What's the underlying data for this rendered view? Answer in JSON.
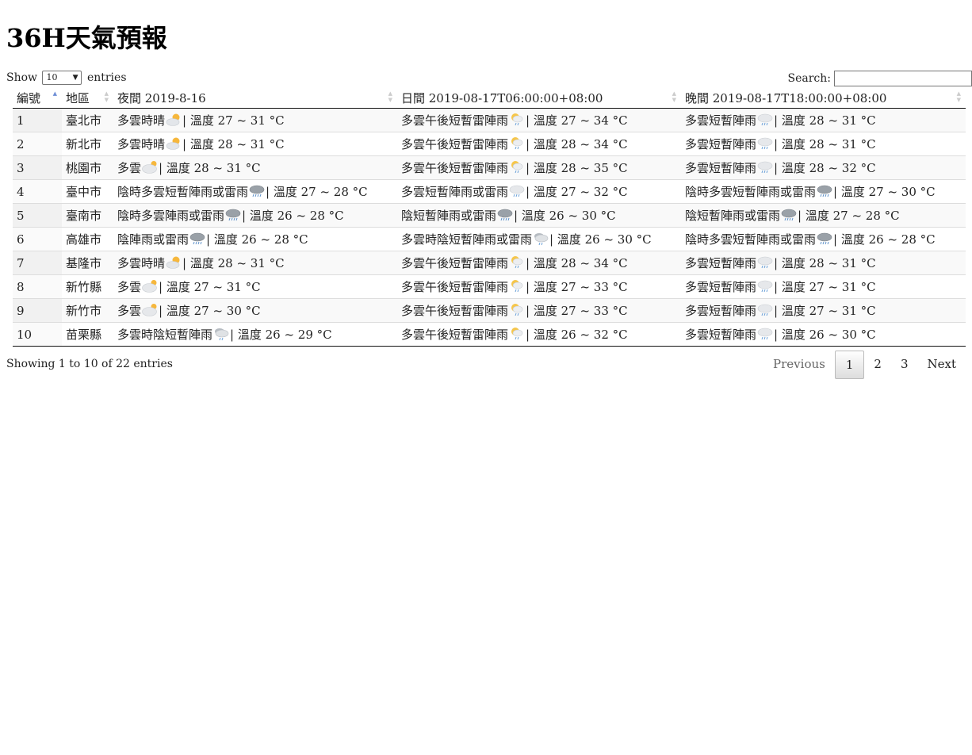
{
  "title": "36H天氣預報",
  "length": {
    "show_label": "Show",
    "value": "10",
    "entries_label": "entries"
  },
  "search": {
    "label": "Search:",
    "value": ""
  },
  "columns": [
    "編號",
    "地區",
    "夜間 2019-8-16",
    "日間 2019-08-17T06:00:00+08:00",
    "晚間 2019-08-17T18:00:00+08:00"
  ],
  "rows": [
    {
      "no": "1",
      "city": "臺北市",
      "p1": {
        "desc": "多雲時晴",
        "icon": "partly-sunny-icon",
        "temp": "| 溫度 27 ~ 31 °C"
      },
      "p2": {
        "desc": "多雲午後短暫雷陣雨",
        "icon": "sun-rain-icon",
        "temp": "| 溫度 27 ~ 34 °C"
      },
      "p3": {
        "desc": "多雲短暫陣雨",
        "icon": "cloud-rain-icon",
        "temp": "| 溫度 28 ~ 31 °C"
      }
    },
    {
      "no": "2",
      "city": "新北市",
      "p1": {
        "desc": "多雲時晴",
        "icon": "partly-sunny-icon",
        "temp": "| 溫度 28 ~ 31 °C"
      },
      "p2": {
        "desc": "多雲午後短暫雷陣雨",
        "icon": "sun-rain-icon",
        "temp": "| 溫度 28 ~ 34 °C"
      },
      "p3": {
        "desc": "多雲短暫陣雨",
        "icon": "cloud-rain-icon",
        "temp": "| 溫度 28 ~ 31 °C"
      }
    },
    {
      "no": "3",
      "city": "桃園市",
      "p1": {
        "desc": "多雲",
        "icon": "cloudy-icon",
        "temp": "| 溫度 28 ~ 31 °C"
      },
      "p2": {
        "desc": "多雲午後短暫雷陣雨",
        "icon": "sun-rain-icon",
        "temp": "| 溫度 28 ~ 35 °C"
      },
      "p3": {
        "desc": "多雲短暫陣雨",
        "icon": "cloud-rain-icon",
        "temp": "| 溫度 28 ~ 32 °C"
      }
    },
    {
      "no": "4",
      "city": "臺中市",
      "p1": {
        "desc": "陰時多雲短暫陣雨或雷雨",
        "icon": "thunder-rain-icon",
        "temp": "| 溫度 27 ~ 28 °C"
      },
      "p2": {
        "desc": "多雲短暫陣雨或雷雨",
        "icon": "cloud-rain-icon",
        "temp": "| 溫度 27 ~ 32 °C"
      },
      "p3": {
        "desc": "陰時多雲短暫陣雨或雷雨",
        "icon": "thunder-rain-icon",
        "temp": "| 溫度 27 ~ 30 °C"
      }
    },
    {
      "no": "5",
      "city": "臺南市",
      "p1": {
        "desc": "陰時多雲陣雨或雷雨",
        "icon": "thunder-rain-icon",
        "temp": "| 溫度 26 ~ 28 °C"
      },
      "p2": {
        "desc": "陰短暫陣雨或雷雨",
        "icon": "thunder-rain-icon",
        "temp": "| 溫度 26 ~ 30 °C"
      },
      "p3": {
        "desc": "陰短暫陣雨或雷雨",
        "icon": "thunder-rain-icon",
        "temp": "| 溫度 27 ~ 28 °C"
      }
    },
    {
      "no": "6",
      "city": "高雄市",
      "p1": {
        "desc": "陰陣雨或雷雨",
        "icon": "thunder-rain-icon",
        "temp": "| 溫度 26 ~ 28 °C"
      },
      "p2": {
        "desc": "多雲時陰短暫陣雨或雷雨",
        "icon": "overcast-rain-icon",
        "temp": "| 溫度 26 ~ 30 °C"
      },
      "p3": {
        "desc": "陰時多雲短暫陣雨或雷雨",
        "icon": "thunder-rain-icon",
        "temp": "| 溫度 26 ~ 28 °C"
      }
    },
    {
      "no": "7",
      "city": "基隆市",
      "p1": {
        "desc": "多雲時晴",
        "icon": "partly-sunny-icon",
        "temp": "| 溫度 28 ~ 31 °C"
      },
      "p2": {
        "desc": "多雲午後短暫雷陣雨",
        "icon": "sun-rain-icon",
        "temp": "| 溫度 28 ~ 34 °C"
      },
      "p3": {
        "desc": "多雲短暫陣雨",
        "icon": "cloud-rain-icon",
        "temp": "| 溫度 28 ~ 31 °C"
      }
    },
    {
      "no": "8",
      "city": "新竹縣",
      "p1": {
        "desc": "多雲",
        "icon": "cloudy-icon",
        "temp": "| 溫度 27 ~ 31 °C"
      },
      "p2": {
        "desc": "多雲午後短暫雷陣雨",
        "icon": "sun-rain-icon",
        "temp": "| 溫度 27 ~ 33 °C"
      },
      "p3": {
        "desc": "多雲短暫陣雨",
        "icon": "cloud-rain-icon",
        "temp": "| 溫度 27 ~ 31 °C"
      }
    },
    {
      "no": "9",
      "city": "新竹市",
      "p1": {
        "desc": "多雲",
        "icon": "cloudy-icon",
        "temp": "| 溫度 27 ~ 30 °C"
      },
      "p2": {
        "desc": "多雲午後短暫雷陣雨",
        "icon": "sun-rain-icon",
        "temp": "| 溫度 27 ~ 33 °C"
      },
      "p3": {
        "desc": "多雲短暫陣雨",
        "icon": "cloud-rain-icon",
        "temp": "| 溫度 27 ~ 31 °C"
      }
    },
    {
      "no": "10",
      "city": "苗栗縣",
      "p1": {
        "desc": "多雲時陰短暫陣雨",
        "icon": "overcast-rain-icon",
        "temp": "| 溫度 26 ~ 29 °C"
      },
      "p2": {
        "desc": "多雲午後短暫雷陣雨",
        "icon": "sun-rain-icon",
        "temp": "| 溫度 26 ~ 32 °C"
      },
      "p3": {
        "desc": "多雲短暫陣雨",
        "icon": "cloud-rain-icon",
        "temp": "| 溫度 26 ~ 30 °C"
      }
    }
  ],
  "info": "Showing 1 to 10 of 22 entries",
  "pagination": {
    "previous": "Previous",
    "pages": [
      "1",
      "2",
      "3"
    ],
    "current": "1",
    "next": "Next"
  },
  "colors": {
    "sort_active": "#6f8fd6",
    "row_stripe": "#f9f9f9",
    "border": "#111111"
  }
}
